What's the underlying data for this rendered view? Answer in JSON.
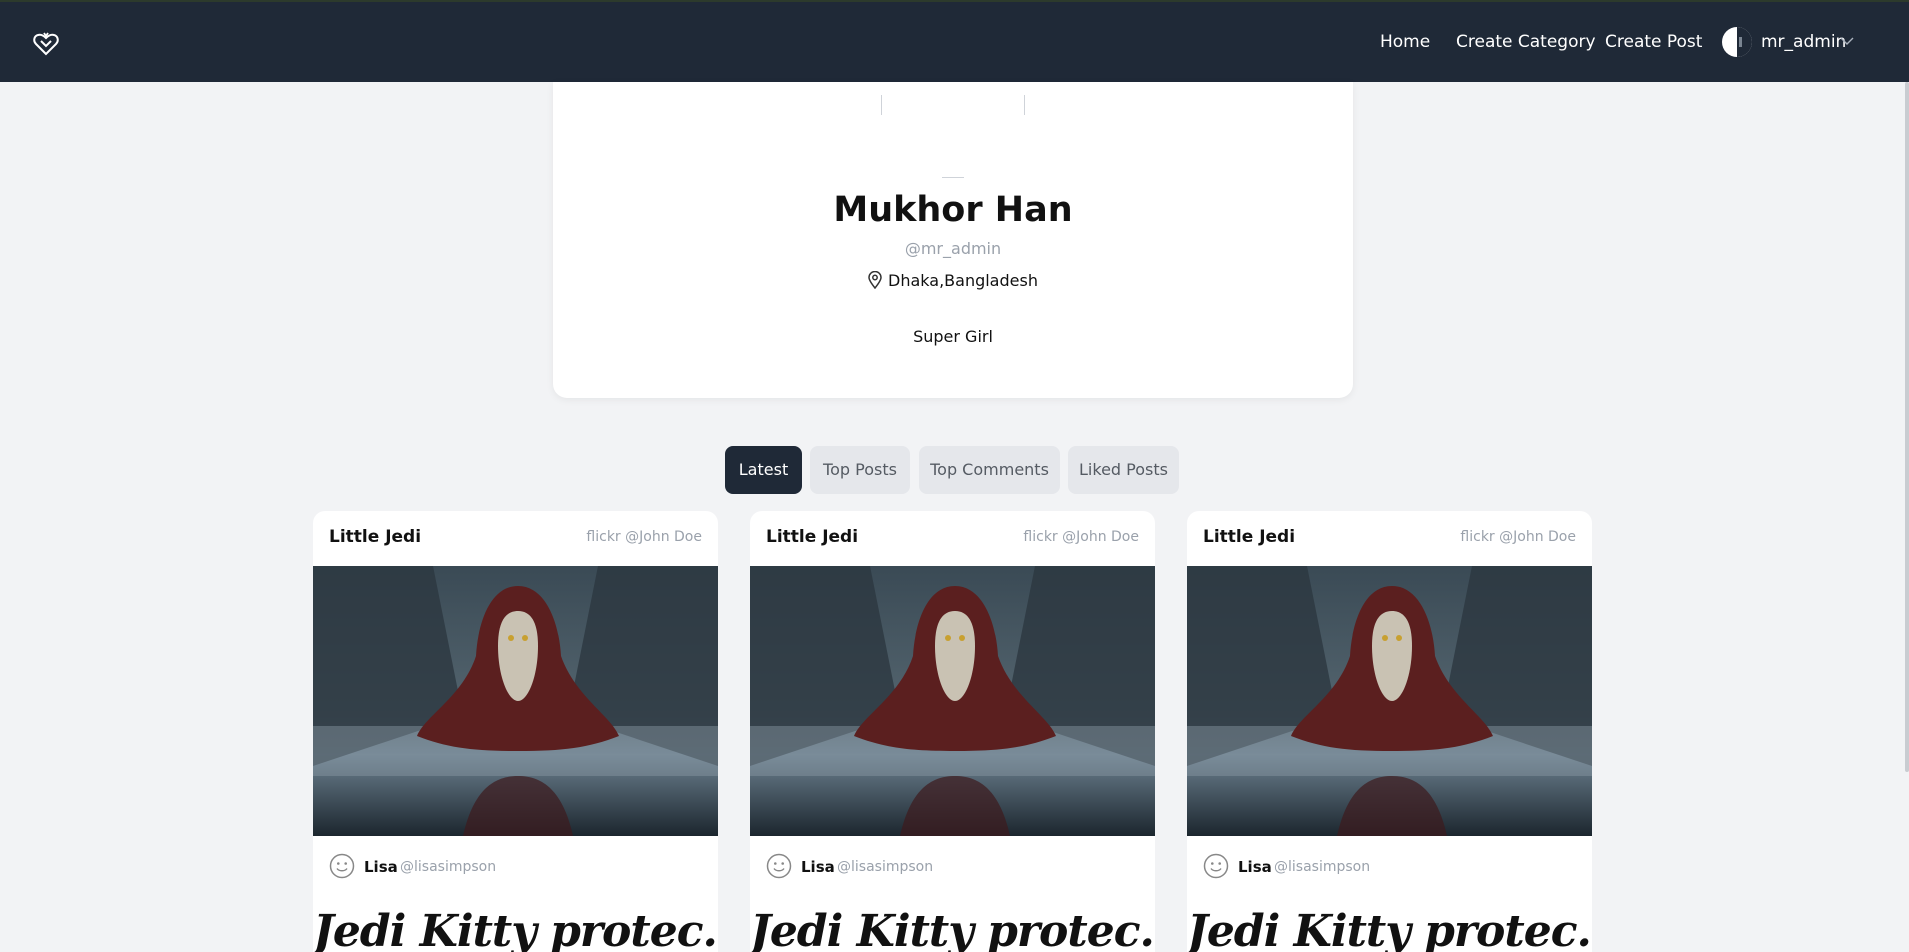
{
  "navbar": {
    "logo_icon": "heart-shield-icon",
    "links": [
      "Home",
      "Create Category",
      "Create Post"
    ],
    "user": {
      "name": "mr_admin",
      "avatar_icon": "avatar-icon",
      "menu_icon": "chevron-down-icon"
    }
  },
  "profile": {
    "name": "Mukhor Han",
    "handle": "@mr_admin",
    "location": "Dhaka,Bangladesh",
    "location_icon": "map-pin-icon",
    "bio": "Super Girl"
  },
  "tabs": [
    {
      "label": "Latest",
      "active": true
    },
    {
      "label": "Top Posts",
      "active": false
    },
    {
      "label": "Top Comments",
      "active": false
    },
    {
      "label": "Liked Posts",
      "active": false
    }
  ],
  "posts": [
    {
      "title": "Little Jedi",
      "source": "flickr @John Doe",
      "image": "hooded-cat-photo",
      "author": "Lisa",
      "author_handle": "@lisasimpson",
      "heading": "Jedi Kitty protec..."
    },
    {
      "title": "Little Jedi",
      "source": "flickr @John Doe",
      "image": "hooded-cat-photo",
      "author": "Lisa",
      "author_handle": "@lisasimpson",
      "heading": "Jedi Kitty protec..."
    },
    {
      "title": "Little Jedi",
      "source": "flickr @John Doe",
      "image": "hooded-cat-photo",
      "author": "Lisa",
      "author_handle": "@lisasimpson",
      "heading": "Jedi Kitty protec..."
    }
  ],
  "colors": {
    "navbar_bg": "#1f2937",
    "page_bg": "#f2f3f5",
    "active_tab_bg": "#1f2937",
    "inactive_tab_bg": "#e5e7eb",
    "muted_text": "#9aa1ab"
  }
}
